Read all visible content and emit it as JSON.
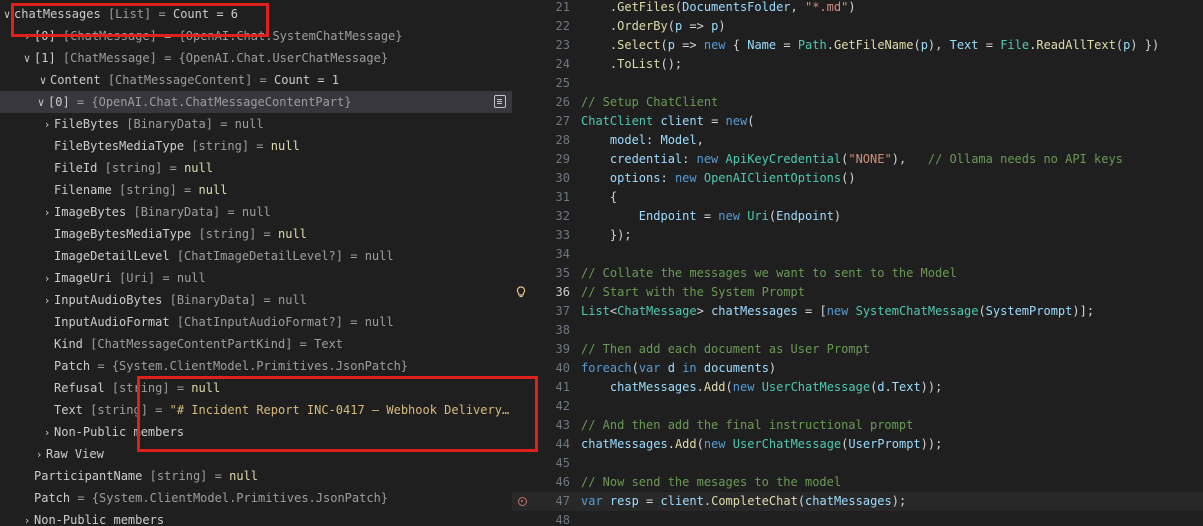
{
  "watch": {
    "rows": [
      {
        "chev": "∨",
        "name": "chatMessages",
        "type": "[List]",
        "value": "Count = 6",
        "kind": "count"
      },
      {
        "chev": "›",
        "name": "[0]",
        "type": "[ChatMessage]",
        "value": "{OpenAI.Chat.SystemChatMessage}",
        "kind": "obj"
      },
      {
        "chev": "∨",
        "name": "[1]",
        "type": "[ChatMessage]",
        "value": "{OpenAI.Chat.UserChatMessage}",
        "kind": "obj"
      },
      {
        "chev": "∨",
        "name": "Content",
        "type": "[ChatMessageContent]",
        "value": "Count = 1",
        "kind": "count"
      },
      {
        "chev": "∨",
        "name": "[0]",
        "type": "",
        "value": "{OpenAI.Chat.ChatMessageContentPart}",
        "kind": "obj"
      },
      {
        "chev": "›",
        "name": "FileBytes",
        "type": "[BinaryData]",
        "value": "null",
        "kind": "objnull"
      },
      {
        "chev": "",
        "name": "FileBytesMediaType",
        "type": "[string]",
        "value": "null",
        "kind": "null"
      },
      {
        "chev": "",
        "name": "FileId",
        "type": "[string]",
        "value": "null",
        "kind": "null"
      },
      {
        "chev": "",
        "name": "Filename",
        "type": "[string]",
        "value": "null",
        "kind": "null"
      },
      {
        "chev": "›",
        "name": "ImageBytes",
        "type": "[BinaryData]",
        "value": "null",
        "kind": "objnull"
      },
      {
        "chev": "",
        "name": "ImageBytesMediaType",
        "type": "[string]",
        "value": "null",
        "kind": "null"
      },
      {
        "chev": "",
        "name": "ImageDetailLevel",
        "type": "[ChatImageDetailLevel?]",
        "value": "null",
        "kind": "objnull"
      },
      {
        "chev": "›",
        "name": "ImageUri",
        "type": "[Uri]",
        "value": "null",
        "kind": "objnull"
      },
      {
        "chev": "›",
        "name": "InputAudioBytes",
        "type": "[BinaryData]",
        "value": "null",
        "kind": "objnull"
      },
      {
        "chev": "",
        "name": "InputAudioFormat",
        "type": "[ChatInputAudioFormat?]",
        "value": "null",
        "kind": "objnull"
      },
      {
        "chev": "",
        "name": "Kind",
        "type": "[ChatMessageContentPartKind]",
        "value": "Text",
        "kind": "obj"
      },
      {
        "chev": "",
        "name": "Patch",
        "type": "",
        "value": "{System.ClientModel.Primitives.JsonPatch}",
        "kind": "obj"
      },
      {
        "chev": "",
        "name": "Refusal",
        "type": "[string]",
        "value": "null",
        "kind": "null"
      },
      {
        "chev": "",
        "name": "Text",
        "type": "[string]",
        "value": "\"# Incident Report INC-0417 — Webhook Delivery…",
        "kind": "str"
      },
      {
        "chev": "›",
        "name": "Non-Public members",
        "type": "",
        "value": "",
        "kind": "none"
      },
      {
        "chev": "›",
        "name": "Raw View",
        "type": "",
        "value": "",
        "kind": "none"
      },
      {
        "chev": "",
        "name": "ParticipantName",
        "type": "[string]",
        "value": "null",
        "kind": "null"
      },
      {
        "chev": "",
        "name": "Patch",
        "type": "",
        "value": "{System.ClientModel.Primitives.JsonPatch}",
        "kind": "obj"
      },
      {
        "chev": "›",
        "name": "Non-Public members",
        "type": "",
        "value": "",
        "kind": "none"
      }
    ]
  },
  "editor": {
    "lines": [
      {
        "n": "21",
        "tokens": [
          [
            "pl",
            "    ."
          ],
          [
            "fn",
            "GetFiles"
          ],
          [
            "pl",
            "("
          ],
          [
            "vr",
            "DocumentsFolder"
          ],
          [
            "pl",
            ", "
          ],
          [
            "st",
            "\"*.md\""
          ],
          [
            "pl",
            ")"
          ]
        ]
      },
      {
        "n": "22",
        "tokens": [
          [
            "pl",
            "    ."
          ],
          [
            "fn",
            "OrderBy"
          ],
          [
            "pl",
            "("
          ],
          [
            "vr",
            "p"
          ],
          [
            "pl",
            " => "
          ],
          [
            "vr",
            "p"
          ],
          [
            "pl",
            ")"
          ]
        ]
      },
      {
        "n": "23",
        "tokens": [
          [
            "pl",
            "    ."
          ],
          [
            "fn",
            "Select"
          ],
          [
            "pl",
            "("
          ],
          [
            "vr",
            "p"
          ],
          [
            "pl",
            " => "
          ],
          [
            "kw",
            "new"
          ],
          [
            "pl",
            " { "
          ],
          [
            "vr",
            "Name"
          ],
          [
            "pl",
            " = "
          ],
          [
            "tp",
            "Path"
          ],
          [
            "pl",
            "."
          ],
          [
            "fn",
            "GetFileName"
          ],
          [
            "pl",
            "("
          ],
          [
            "vr",
            "p"
          ],
          [
            "pl",
            "), "
          ],
          [
            "vr",
            "Text"
          ],
          [
            "pl",
            " = "
          ],
          [
            "tp",
            "File"
          ],
          [
            "pl",
            "."
          ],
          [
            "fn",
            "ReadAllText"
          ],
          [
            "pl",
            "("
          ],
          [
            "vr",
            "p"
          ],
          [
            "pl",
            ") })"
          ]
        ]
      },
      {
        "n": "24",
        "tokens": [
          [
            "pl",
            "    ."
          ],
          [
            "fn",
            "ToList"
          ],
          [
            "pl",
            "();"
          ]
        ]
      },
      {
        "n": "25",
        "tokens": []
      },
      {
        "n": "26",
        "tokens": [
          [
            "cm",
            "// Setup ChatClient"
          ]
        ]
      },
      {
        "n": "27",
        "tokens": [
          [
            "tp",
            "ChatClient"
          ],
          [
            "pl",
            " "
          ],
          [
            "vr",
            "client"
          ],
          [
            "pl",
            " = "
          ],
          [
            "kw",
            "new"
          ],
          [
            "pl",
            "("
          ]
        ]
      },
      {
        "n": "28",
        "tokens": [
          [
            "pl",
            "    "
          ],
          [
            "vr",
            "model"
          ],
          [
            "pl",
            ": "
          ],
          [
            "vr",
            "Model"
          ],
          [
            "pl",
            ","
          ]
        ]
      },
      {
        "n": "29",
        "tokens": [
          [
            "pl",
            "    "
          ],
          [
            "vr",
            "credential"
          ],
          [
            "pl",
            ": "
          ],
          [
            "kw",
            "new"
          ],
          [
            "pl",
            " "
          ],
          [
            "tp",
            "ApiKeyCredential"
          ],
          [
            "pl",
            "("
          ],
          [
            "st",
            "\"NONE\""
          ],
          [
            "pl",
            "),   "
          ],
          [
            "cm",
            "// Ollama needs no API keys"
          ]
        ]
      },
      {
        "n": "30",
        "tokens": [
          [
            "pl",
            "    "
          ],
          [
            "vr",
            "options"
          ],
          [
            "pl",
            ": "
          ],
          [
            "kw",
            "new"
          ],
          [
            "pl",
            " "
          ],
          [
            "tp",
            "OpenAIClientOptions"
          ],
          [
            "pl",
            "()"
          ]
        ]
      },
      {
        "n": "31",
        "tokens": [
          [
            "pl",
            "    {"
          ]
        ]
      },
      {
        "n": "32",
        "tokens": [
          [
            "pl",
            "        "
          ],
          [
            "vr",
            "Endpoint"
          ],
          [
            "pl",
            " = "
          ],
          [
            "kw",
            "new"
          ],
          [
            "pl",
            " "
          ],
          [
            "tp",
            "Uri"
          ],
          [
            "pl",
            "("
          ],
          [
            "vr",
            "Endpoint"
          ],
          [
            "pl",
            ")"
          ]
        ]
      },
      {
        "n": "33",
        "tokens": [
          [
            "pl",
            "    });"
          ]
        ]
      },
      {
        "n": "34",
        "tokens": []
      },
      {
        "n": "35",
        "tokens": [
          [
            "cm",
            "// Collate the messages we want to sent to the Model"
          ]
        ]
      },
      {
        "n": "36",
        "tokens": [
          [
            "cm",
            "// Start with the System Prompt"
          ]
        ],
        "active": true,
        "gutterIcon": "bulb"
      },
      {
        "n": "37",
        "tokens": [
          [
            "tp",
            "List"
          ],
          [
            "pl",
            "<"
          ],
          [
            "tp",
            "ChatMessage"
          ],
          [
            "pl",
            "> "
          ],
          [
            "vr",
            "chatMessages"
          ],
          [
            "pl",
            " = ["
          ],
          [
            "kw",
            "new"
          ],
          [
            "pl",
            " "
          ],
          [
            "tp",
            "SystemChatMessage"
          ],
          [
            "pl",
            "("
          ],
          [
            "vr",
            "SystemPrompt"
          ],
          [
            "pl",
            ")];"
          ]
        ]
      },
      {
        "n": "38",
        "tokens": []
      },
      {
        "n": "39",
        "tokens": [
          [
            "cm",
            "// Then add each document as User Prompt"
          ]
        ]
      },
      {
        "n": "40",
        "tokens": [
          [
            "kw",
            "foreach"
          ],
          [
            "pl",
            "("
          ],
          [
            "kw",
            "var"
          ],
          [
            "pl",
            " "
          ],
          [
            "vr",
            "d"
          ],
          [
            "pl",
            " "
          ],
          [
            "kw",
            "in"
          ],
          [
            "pl",
            " "
          ],
          [
            "vr",
            "documents"
          ],
          [
            "pl",
            ")"
          ]
        ]
      },
      {
        "n": "41",
        "tokens": [
          [
            "pl",
            "    "
          ],
          [
            "vr",
            "chatMessages"
          ],
          [
            "pl",
            "."
          ],
          [
            "fn",
            "Add"
          ],
          [
            "pl",
            "("
          ],
          [
            "kw",
            "new"
          ],
          [
            "pl",
            " "
          ],
          [
            "tp",
            "UserChatMessage"
          ],
          [
            "pl",
            "("
          ],
          [
            "vr",
            "d"
          ],
          [
            "pl",
            "."
          ],
          [
            "vr",
            "Text"
          ],
          [
            "pl",
            "));"
          ]
        ]
      },
      {
        "n": "42",
        "tokens": []
      },
      {
        "n": "43",
        "tokens": [
          [
            "cm",
            "// And then add the final instructional prompt"
          ]
        ]
      },
      {
        "n": "44",
        "tokens": [
          [
            "vr",
            "chatMessages"
          ],
          [
            "pl",
            "."
          ],
          [
            "fn",
            "Add"
          ],
          [
            "pl",
            "("
          ],
          [
            "kw",
            "new"
          ],
          [
            "pl",
            " "
          ],
          [
            "tp",
            "UserChatMessage"
          ],
          [
            "pl",
            "("
          ],
          [
            "vr",
            "UserPrompt"
          ],
          [
            "pl",
            "));"
          ]
        ]
      },
      {
        "n": "45",
        "tokens": []
      },
      {
        "n": "46",
        "tokens": [
          [
            "cm",
            "// Now send the mesages to the model"
          ]
        ]
      },
      {
        "n": "47",
        "tokens": [
          [
            "kw",
            "var"
          ],
          [
            "pl",
            " "
          ],
          [
            "vr",
            "resp"
          ],
          [
            "pl",
            " = "
          ],
          [
            "vr",
            "client"
          ],
          [
            "pl",
            "."
          ],
          [
            "fn",
            "CompleteChat"
          ],
          [
            "pl",
            "("
          ],
          [
            "vr",
            "chatMessages"
          ],
          [
            "pl",
            ");"
          ]
        ],
        "current": true,
        "gutterIcon": "breakpoint"
      },
      {
        "n": "48",
        "tokens": []
      }
    ]
  },
  "colors": {
    "highlight": "#e0201c",
    "selection": "#37373d"
  }
}
